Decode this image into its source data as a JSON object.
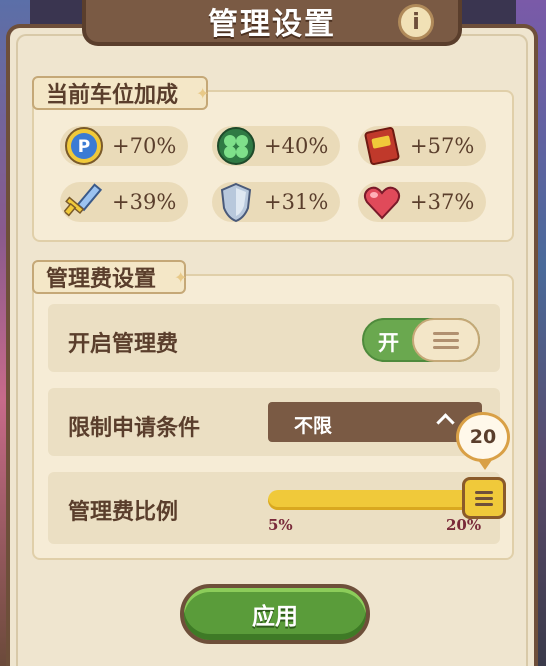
{
  "header": {
    "title": "管理设置",
    "info_label": "i"
  },
  "bonus_section": {
    "title": "当前车位加成",
    "items": [
      {
        "icon": "p-coin-icon",
        "value": "+70%",
        "color": "#3b7bd4"
      },
      {
        "icon": "clover-icon",
        "value": "+40%",
        "color": "#3aa85a"
      },
      {
        "icon": "book-icon",
        "value": "+57%",
        "color": "#c0392b"
      },
      {
        "icon": "sword-icon",
        "value": "+39%",
        "color": "#5a8ad4"
      },
      {
        "icon": "shield-icon",
        "value": "+31%",
        "color": "#9aaecc"
      },
      {
        "icon": "heart-icon",
        "value": "+37%",
        "color": "#d94a5a"
      }
    ]
  },
  "fee_section": {
    "title": "管理费设置",
    "enable_label": "开启管理费",
    "toggle_text": "开",
    "toggle_on": true,
    "limit_label": "限制申请条件",
    "limit_value": "不限",
    "ratio_label": "管理费比例",
    "ratio_value": "20",
    "ratio_min": "5%",
    "ratio_max": "20%"
  },
  "apply_label": "应用"
}
